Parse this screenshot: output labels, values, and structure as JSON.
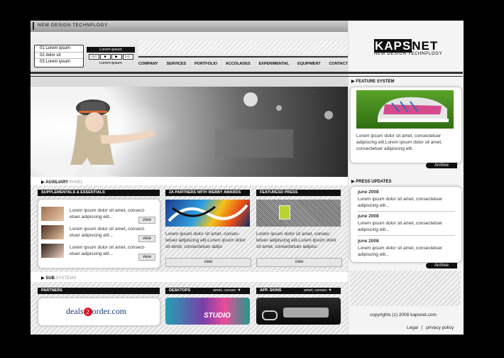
{
  "header": {
    "tagline": "NEW DESIGN TECHNPLOGY",
    "list": [
      "01 Lorem ipsum",
      "02 dolor sit",
      "03 Lorem ipsum"
    ],
    "player_title": "Lorem ipsum",
    "player_controls": [
      "◁◁",
      "■",
      "▶",
      "▷▷"
    ],
    "player_caption": "Lorem ipsum"
  },
  "nav": [
    "COMPANY",
    "SERVICES",
    "PORTFOLIO",
    "ACCOLADES",
    "EXPERIMENTAL",
    "EQUIPMENT",
    "CONTACT"
  ],
  "logo": {
    "kaps": "KAPS",
    "net": "NET",
    "sub": "NEW DESIGN TECHNPLOGY"
  },
  "hero": {
    "caption": "…"
  },
  "auxiliary": {
    "bold": "AUXILIARY",
    "light": "PANEL"
  },
  "supplementals": {
    "title": "SUPPLEMENTALS & ESSENTIALS",
    "items": [
      {
        "text": "Lorem ipsum dolor sit amet, consect-etuer adipiscing elit...",
        "btn": "view"
      },
      {
        "text": "Lorem ipsum dolor sit amet, consect-etuer adipiscing elit...",
        "btn": "view"
      },
      {
        "text": "Lorem ipsum dolor sit amet, consect-etuer adipiscing elit...",
        "btn": "view"
      }
    ]
  },
  "partners_webby": {
    "title": "2A PARTNERS WITH WEBBY AWARDS",
    "text": "Lorem ipsum dolor sit amet, consec-tetuer adipiscing elit.Lorem ipsum dolor sit amet, consectetuer adipi-",
    "btn": "view"
  },
  "featured_press": {
    "title": "FEATURESD PRESS",
    "text": "Lorem ipsum dolor sit amet, consec-tetuer adipiscing elit.Lorem ipsum dolor sit amet, consectetuer adipisc-",
    "btn": "view"
  },
  "sub_systems": {
    "bold": "SUB",
    "light": "SYSTEMS"
  },
  "partners": {
    "title": "PARTNERS",
    "logo_pre": "deals",
    "logo_num": "2",
    "logo_post": "order.com"
  },
  "desktops": {
    "title": "DESKTOPS",
    "select": "amet, consec",
    "image_text": "STUDIO"
  },
  "app_skins": {
    "title": "APP. SKINS",
    "select": "amet, consec"
  },
  "feature_system": {
    "title": "FEATURE SYSTEM",
    "text": "Lorem ipsum dolor sit amet, consectetuer adipiscing elit.Lorem ipsum dolor sit amet, consectetuer adipiscing elit.",
    "btn": "Archive"
  },
  "press_updates": {
    "title": "PRESS UPDATES",
    "items": [
      {
        "date": "june 2008",
        "text": "Lorem ipsum dolor sit amet, consectetuer adipiscing elit..."
      },
      {
        "date": "june 2008",
        "text": "Lorem ipsum dolor sit amet, consectetuer adipiscing elit..."
      },
      {
        "date": "june 2008",
        "text": "Lorem ipsum dolor sit amet, consectetuer adipiscing elit..."
      }
    ],
    "btn": "Archive"
  },
  "footer": {
    "copyright": "copyrights (c) 2008 kapsnet.com",
    "legal": "Legal",
    "sep": "|",
    "privacy": "privacy policy"
  }
}
